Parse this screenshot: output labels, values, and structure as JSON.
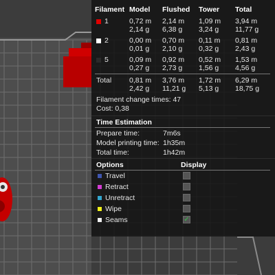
{
  "colors": {
    "bed": "#4a4a4a",
    "grid": "#6e6e6e",
    "bed_edge": "#8a8a8a",
    "object_red": "#cc0000",
    "check_green": "#37c24a"
  },
  "stats": {
    "headers": [
      "Filament",
      "Model",
      "Flushed",
      "Tower",
      "Total"
    ],
    "filaments": [
      {
        "id": "1",
        "color": "#e00000",
        "model_m": "0,72 m",
        "model_g": "2,14 g",
        "flushed_m": "2,14 m",
        "flushed_g": "6,38 g",
        "tower_m": "1,09 m",
        "tower_g": "3,24 g",
        "total_m": "3,94 m",
        "total_g": "11,77 g"
      },
      {
        "id": "2",
        "color": "#ffffff",
        "model_m": "0,00 m",
        "model_g": "0,01 g",
        "flushed_m": "0,70 m",
        "flushed_g": "2,10 g",
        "tower_m": "0,11 m",
        "tower_g": "0,32 g",
        "total_m": "0,81 m",
        "total_g": "2,43 g"
      },
      {
        "id": "5",
        "color": "#2a2a2a",
        "model_m": "0,09 m",
        "model_g": "0,27 g",
        "flushed_m": "0,92 m",
        "flushed_g": "2,73 g",
        "tower_m": "0,52 m",
        "tower_g": "1,56 g",
        "total_m": "1,53 m",
        "total_g": "4,56 g"
      }
    ],
    "total": {
      "label": "Total",
      "model_m": "0,81 m",
      "model_g": "2,42 g",
      "flushed_m": "3,76 m",
      "flushed_g": "11,21 g",
      "tower_m": "1,72 m",
      "tower_g": "5,13 g",
      "total_m": "6,29 m",
      "total_g": "18,75 g"
    },
    "filament_changes": "Filament change times:  47",
    "cost": "Cost:  0,38"
  },
  "time": {
    "title": "Time Estimation",
    "rows": [
      {
        "label": "Prepare time:",
        "value": "7m6s"
      },
      {
        "label": "Model printing time:",
        "value": "1h35m"
      },
      {
        "label": "Total time:",
        "value": "1h42m"
      }
    ]
  },
  "options": {
    "title": "Options",
    "display": "Display",
    "items": [
      {
        "label": "Travel",
        "color": "#3f56b0",
        "checked": false
      },
      {
        "label": "Retract",
        "color": "#d43cd4",
        "checked": false
      },
      {
        "label": "Unretract",
        "color": "#33a7d0",
        "checked": false
      },
      {
        "label": "Wipe",
        "color": "#f2f21a",
        "checked": false
      },
      {
        "label": "Seams",
        "color": "#f0f0f0",
        "checked": true
      }
    ]
  }
}
